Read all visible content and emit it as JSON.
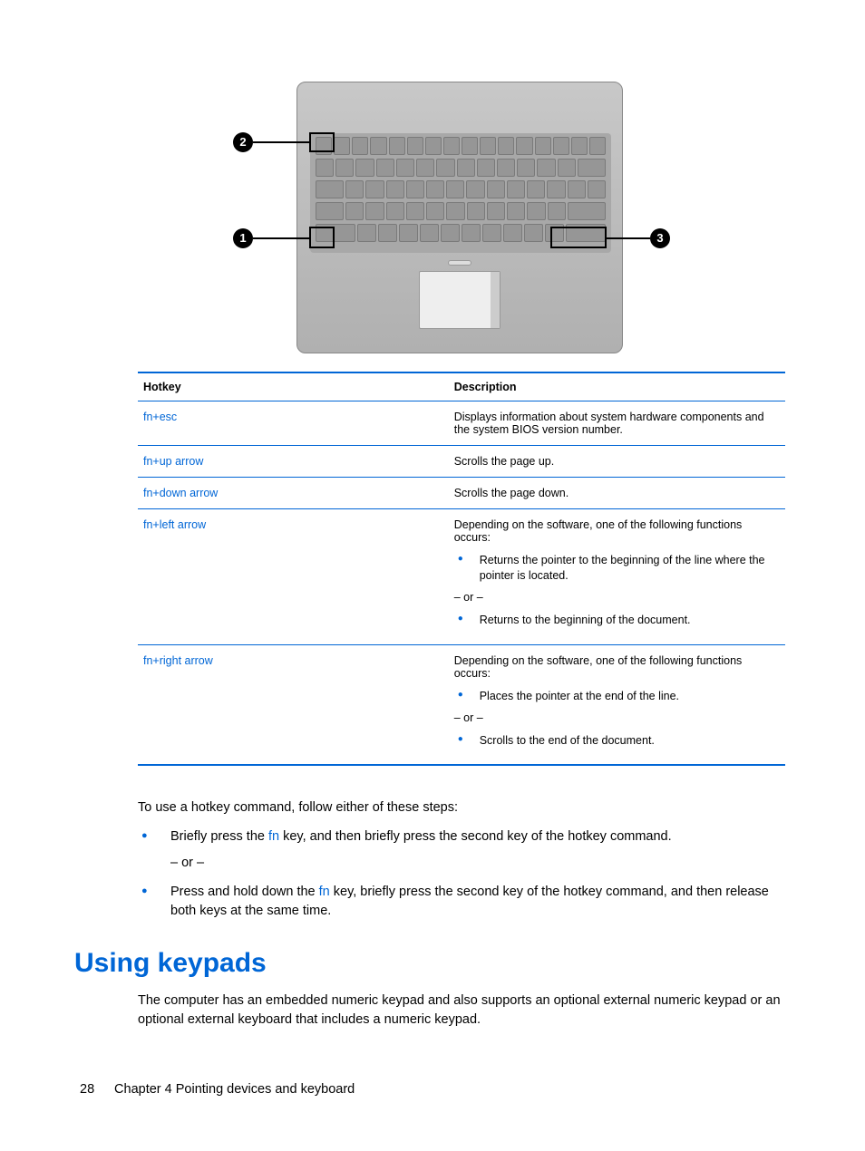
{
  "callouts": {
    "c1": "1",
    "c2": "2",
    "c3": "3"
  },
  "table": {
    "headers": {
      "hotkey": "Hotkey",
      "description": "Description"
    },
    "rows": [
      {
        "hotkey": "fn+esc",
        "desc": "Displays information about system hardware components and the system BIOS version number."
      },
      {
        "hotkey": "fn+up arrow",
        "desc": "Scrolls the page up."
      },
      {
        "hotkey": "fn+down arrow",
        "desc": "Scrolls the page down."
      },
      {
        "hotkey": "fn+left arrow",
        "desc": "Depending on the software, one of the following functions occurs:",
        "b1": "Returns the pointer to the beginning of the line where the pointer is located.",
        "or": "– or –",
        "b2": "Returns to the beginning of the document."
      },
      {
        "hotkey": "fn+right arrow",
        "desc": "Depending on the software, one of the following functions occurs:",
        "b1": "Places the pointer at the end of the line.",
        "or": "– or –",
        "b2": "Scrolls to the end of the document."
      }
    ]
  },
  "instructions": {
    "intro": "To use a hotkey command, follow either of these steps:",
    "step1_pre": "Briefly press the ",
    "fn": "fn",
    "step1_post": " key, and then briefly press the second key of the hotkey command.",
    "or": "– or –",
    "step2_pre": "Press and hold down the ",
    "step2_post": " key, briefly press the second key of the hotkey command, and then release both keys at the same time."
  },
  "section": {
    "title": "Using keypads",
    "para": "The computer has an embedded numeric keypad and also supports an optional external numeric keypad or an optional external keyboard that includes a numeric keypad."
  },
  "footer": {
    "page": "28",
    "chapter": "Chapter 4   Pointing devices and keyboard"
  }
}
